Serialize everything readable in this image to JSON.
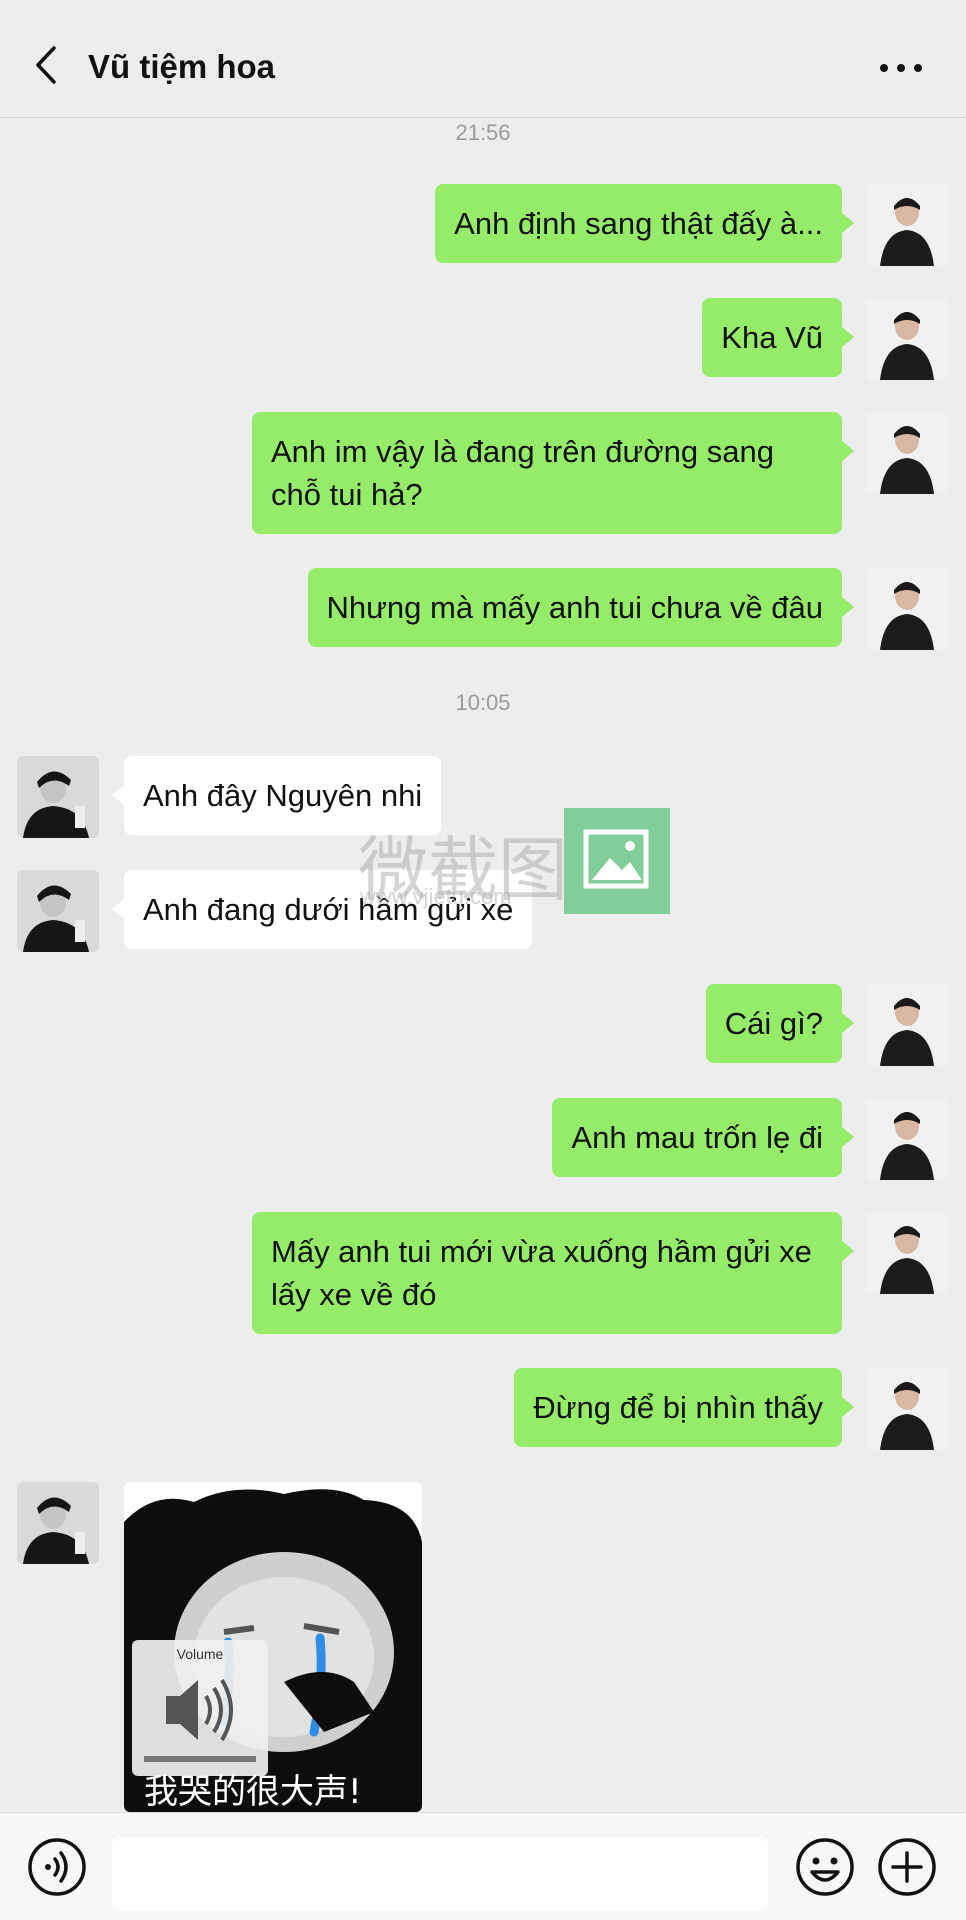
{
  "header": {
    "title": "Vũ tiệm hoa"
  },
  "timestamps": [
    "21:56",
    "10:05"
  ],
  "messages": [
    {
      "from": "me",
      "text": "Anh định sang thật đấy à..."
    },
    {
      "from": "me",
      "text": "Kha Vũ"
    },
    {
      "from": "me",
      "text": "Anh im vậy là đang trên đường sang chỗ tui hả?"
    },
    {
      "from": "me",
      "text": "Nhưng mà mấy anh tui chưa về đâu"
    },
    {
      "from": "them",
      "text": "Anh đây Nguyên nhi"
    },
    {
      "from": "them",
      "text": "Anh đang dưới hầm gửi xe"
    },
    {
      "from": "me",
      "text": "Cái gì?"
    },
    {
      "from": "me",
      "text": "Anh mau trốn lẹ đi"
    },
    {
      "from": "me",
      "text": "Mấy anh tui mới vừa xuống hầm gửi xe lấy xe về đó"
    },
    {
      "from": "me",
      "text": "Đừng để bị nhìn thấy"
    }
  ],
  "sticker": {
    "caption": "我哭的很大声!",
    "volume_label": "Volume"
  },
  "watermark": {
    "text": "微截图",
    "url": "www.vjietu.com"
  },
  "icons": {
    "back": "chevron-left-icon",
    "more": "more-dots-icon",
    "voice": "voice-icon",
    "emoji": "emoji-icon",
    "plus": "plus-icon"
  },
  "colors": {
    "outgoing_bubble": "#95ec69",
    "incoming_bubble": "#ffffff",
    "background": "#ededed"
  }
}
